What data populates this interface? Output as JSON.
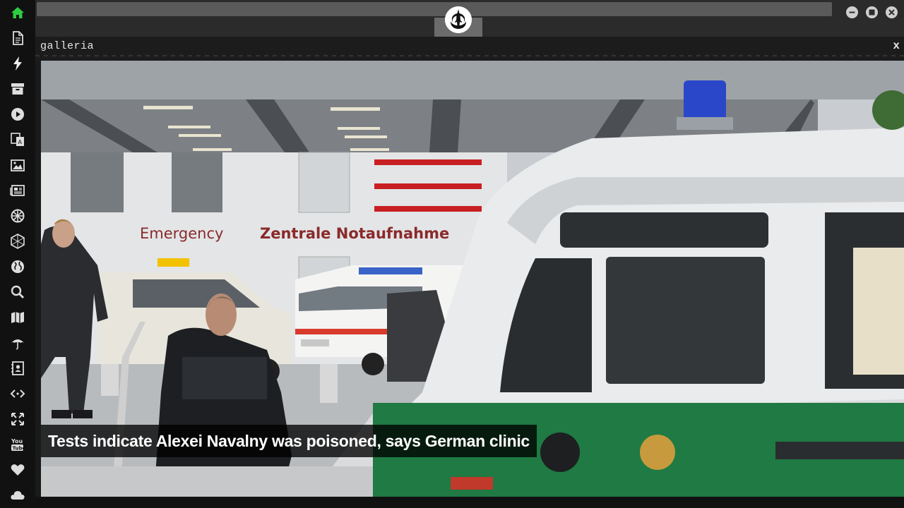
{
  "window": {
    "controls": [
      "minimize-icon",
      "maximize-icon",
      "close-icon"
    ]
  },
  "sidebar": {
    "items": [
      {
        "icon": "home-icon",
        "active": true
      },
      {
        "icon": "document-icon"
      },
      {
        "icon": "lightning-icon"
      },
      {
        "icon": "archive-icon"
      },
      {
        "icon": "play-icon"
      },
      {
        "icon": "translate-icon"
      },
      {
        "icon": "image-icon"
      },
      {
        "icon": "newspaper-icon"
      },
      {
        "icon": "settings-wheel-icon"
      },
      {
        "icon": "hexagon-icon"
      },
      {
        "icon": "globe-icon"
      },
      {
        "icon": "search-icon"
      },
      {
        "icon": "map-icon"
      },
      {
        "icon": "umbrella-icon"
      },
      {
        "icon": "contact-book-icon"
      },
      {
        "icon": "code-icon"
      },
      {
        "icon": "expand-icon"
      },
      {
        "icon": "youtube-icon"
      },
      {
        "icon": "heart-icon"
      },
      {
        "icon": "cloud-icon"
      }
    ],
    "accent_color": "#2ecc40"
  },
  "topbar": {
    "logo_icon": "rebel-alliance-icon"
  },
  "pane": {
    "title": "galleria",
    "close_label": "x"
  },
  "gallery": {
    "caption": "Tests indicate Alexei Navalny was poisoned, says German clinic",
    "image_description_signs": {
      "sign_emergency": "Emergency",
      "sign_german": "Zentrale Notaufnahme"
    }
  }
}
